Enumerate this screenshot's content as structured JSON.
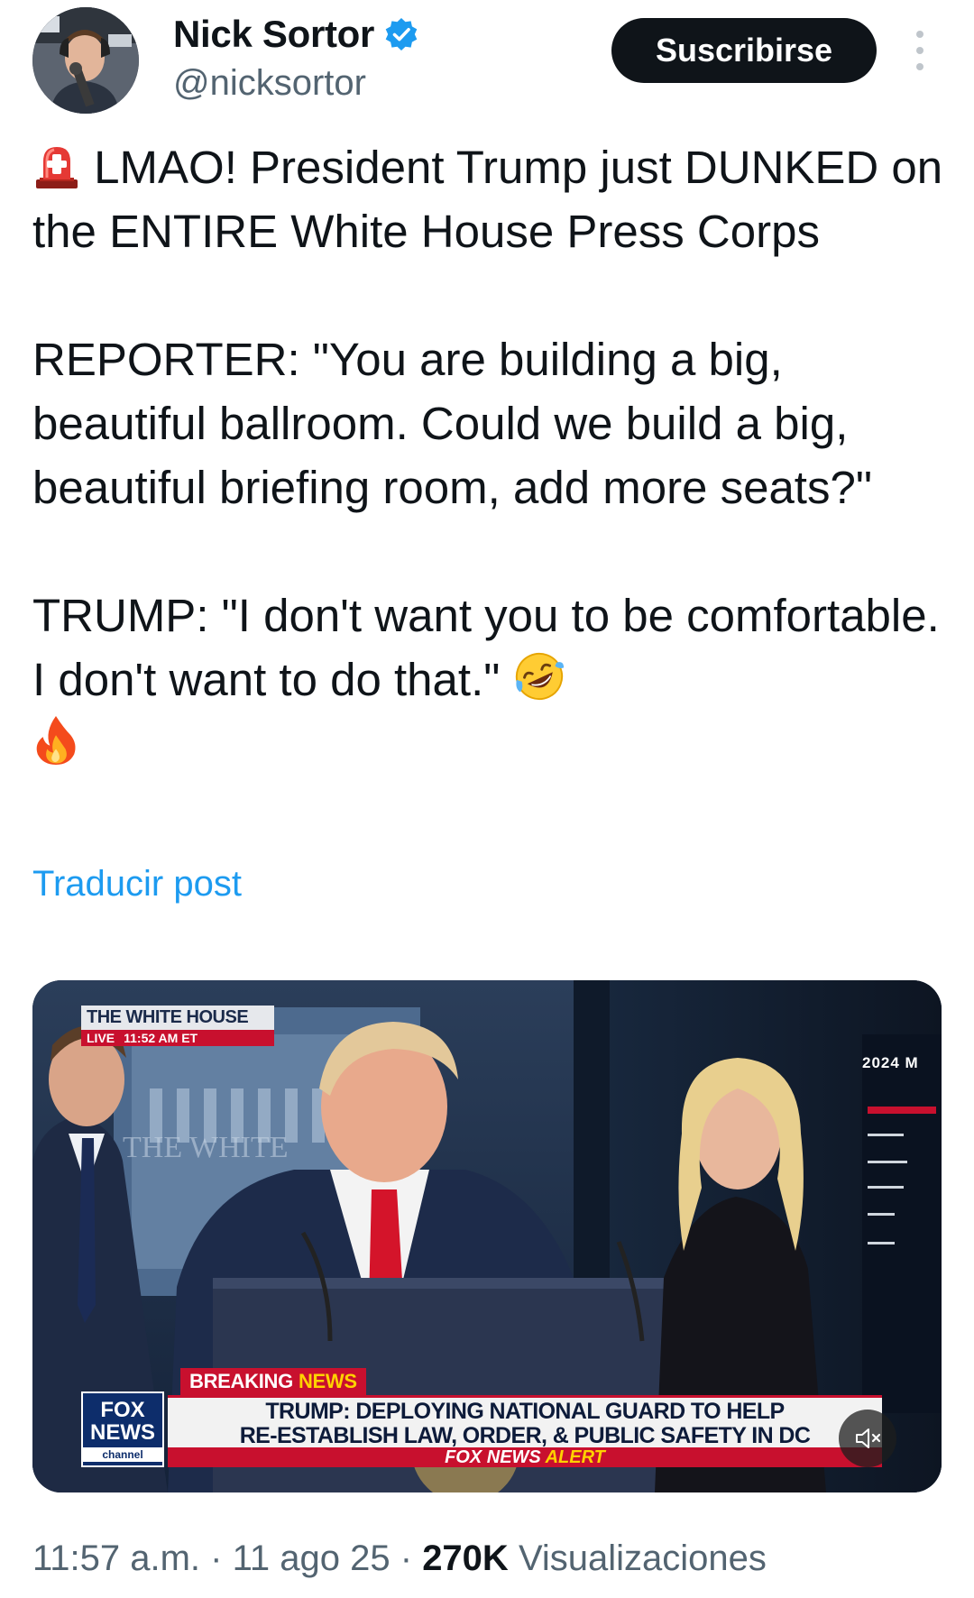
{
  "author": {
    "display_name": "Nick Sortor",
    "handle": "@nicksortor",
    "verified": true
  },
  "actions": {
    "subscribe_label": "Suscribirse",
    "more_icon": "more-vertical-icon"
  },
  "post": {
    "line1": "LMAO! President Trump just DUNKED on the ENTIRE White House Press Corps",
    "line1_emoji": "rotating-light-emoji",
    "paragraph2": "REPORTER: \"You are building a big, beautiful ballroom. Could we build a big, beautiful briefing room, add more seats?\"",
    "paragraph3": "TRUMP: \"I don't want you to be comfortable. I don't want to do that.\"",
    "paragraph3_emojis": [
      "rofl-emoji",
      "fire-emoji"
    ],
    "translate_label": "Traducir post"
  },
  "media": {
    "wh_title": "THE WHITE HOUSE",
    "wh_live": "LIVE",
    "wh_time": "11:52 AM ET",
    "corner_text": "2024 M",
    "background_text": "THE WHITE",
    "fox_logo_top": "FOX",
    "fox_logo_mid": "NEWS",
    "fox_logo_bottom": "channel",
    "breaking_label": "BREAKING",
    "breaking_news": "NEWS",
    "headline_line1": "TRUMP: DEPLOYING NATIONAL GUARD TO HELP",
    "headline_line2": "RE-ESTABLISH LAW, ORDER, & PUBLIC SAFETY IN DC",
    "alert_left": "FOX NEWS",
    "alert_right": "ALERT",
    "mute_icon": "volume-muted-icon"
  },
  "meta": {
    "time": "11:57 a.m.",
    "separator": "·",
    "date": "11 ago 25",
    "views_count": "270K",
    "views_label": "Visualizaciones"
  },
  "colors": {
    "verified_blue": "#1d9bf0",
    "link_blue": "#1d9bf0",
    "fox_red": "#c8102e",
    "fox_navy": "#0d2d6b"
  }
}
